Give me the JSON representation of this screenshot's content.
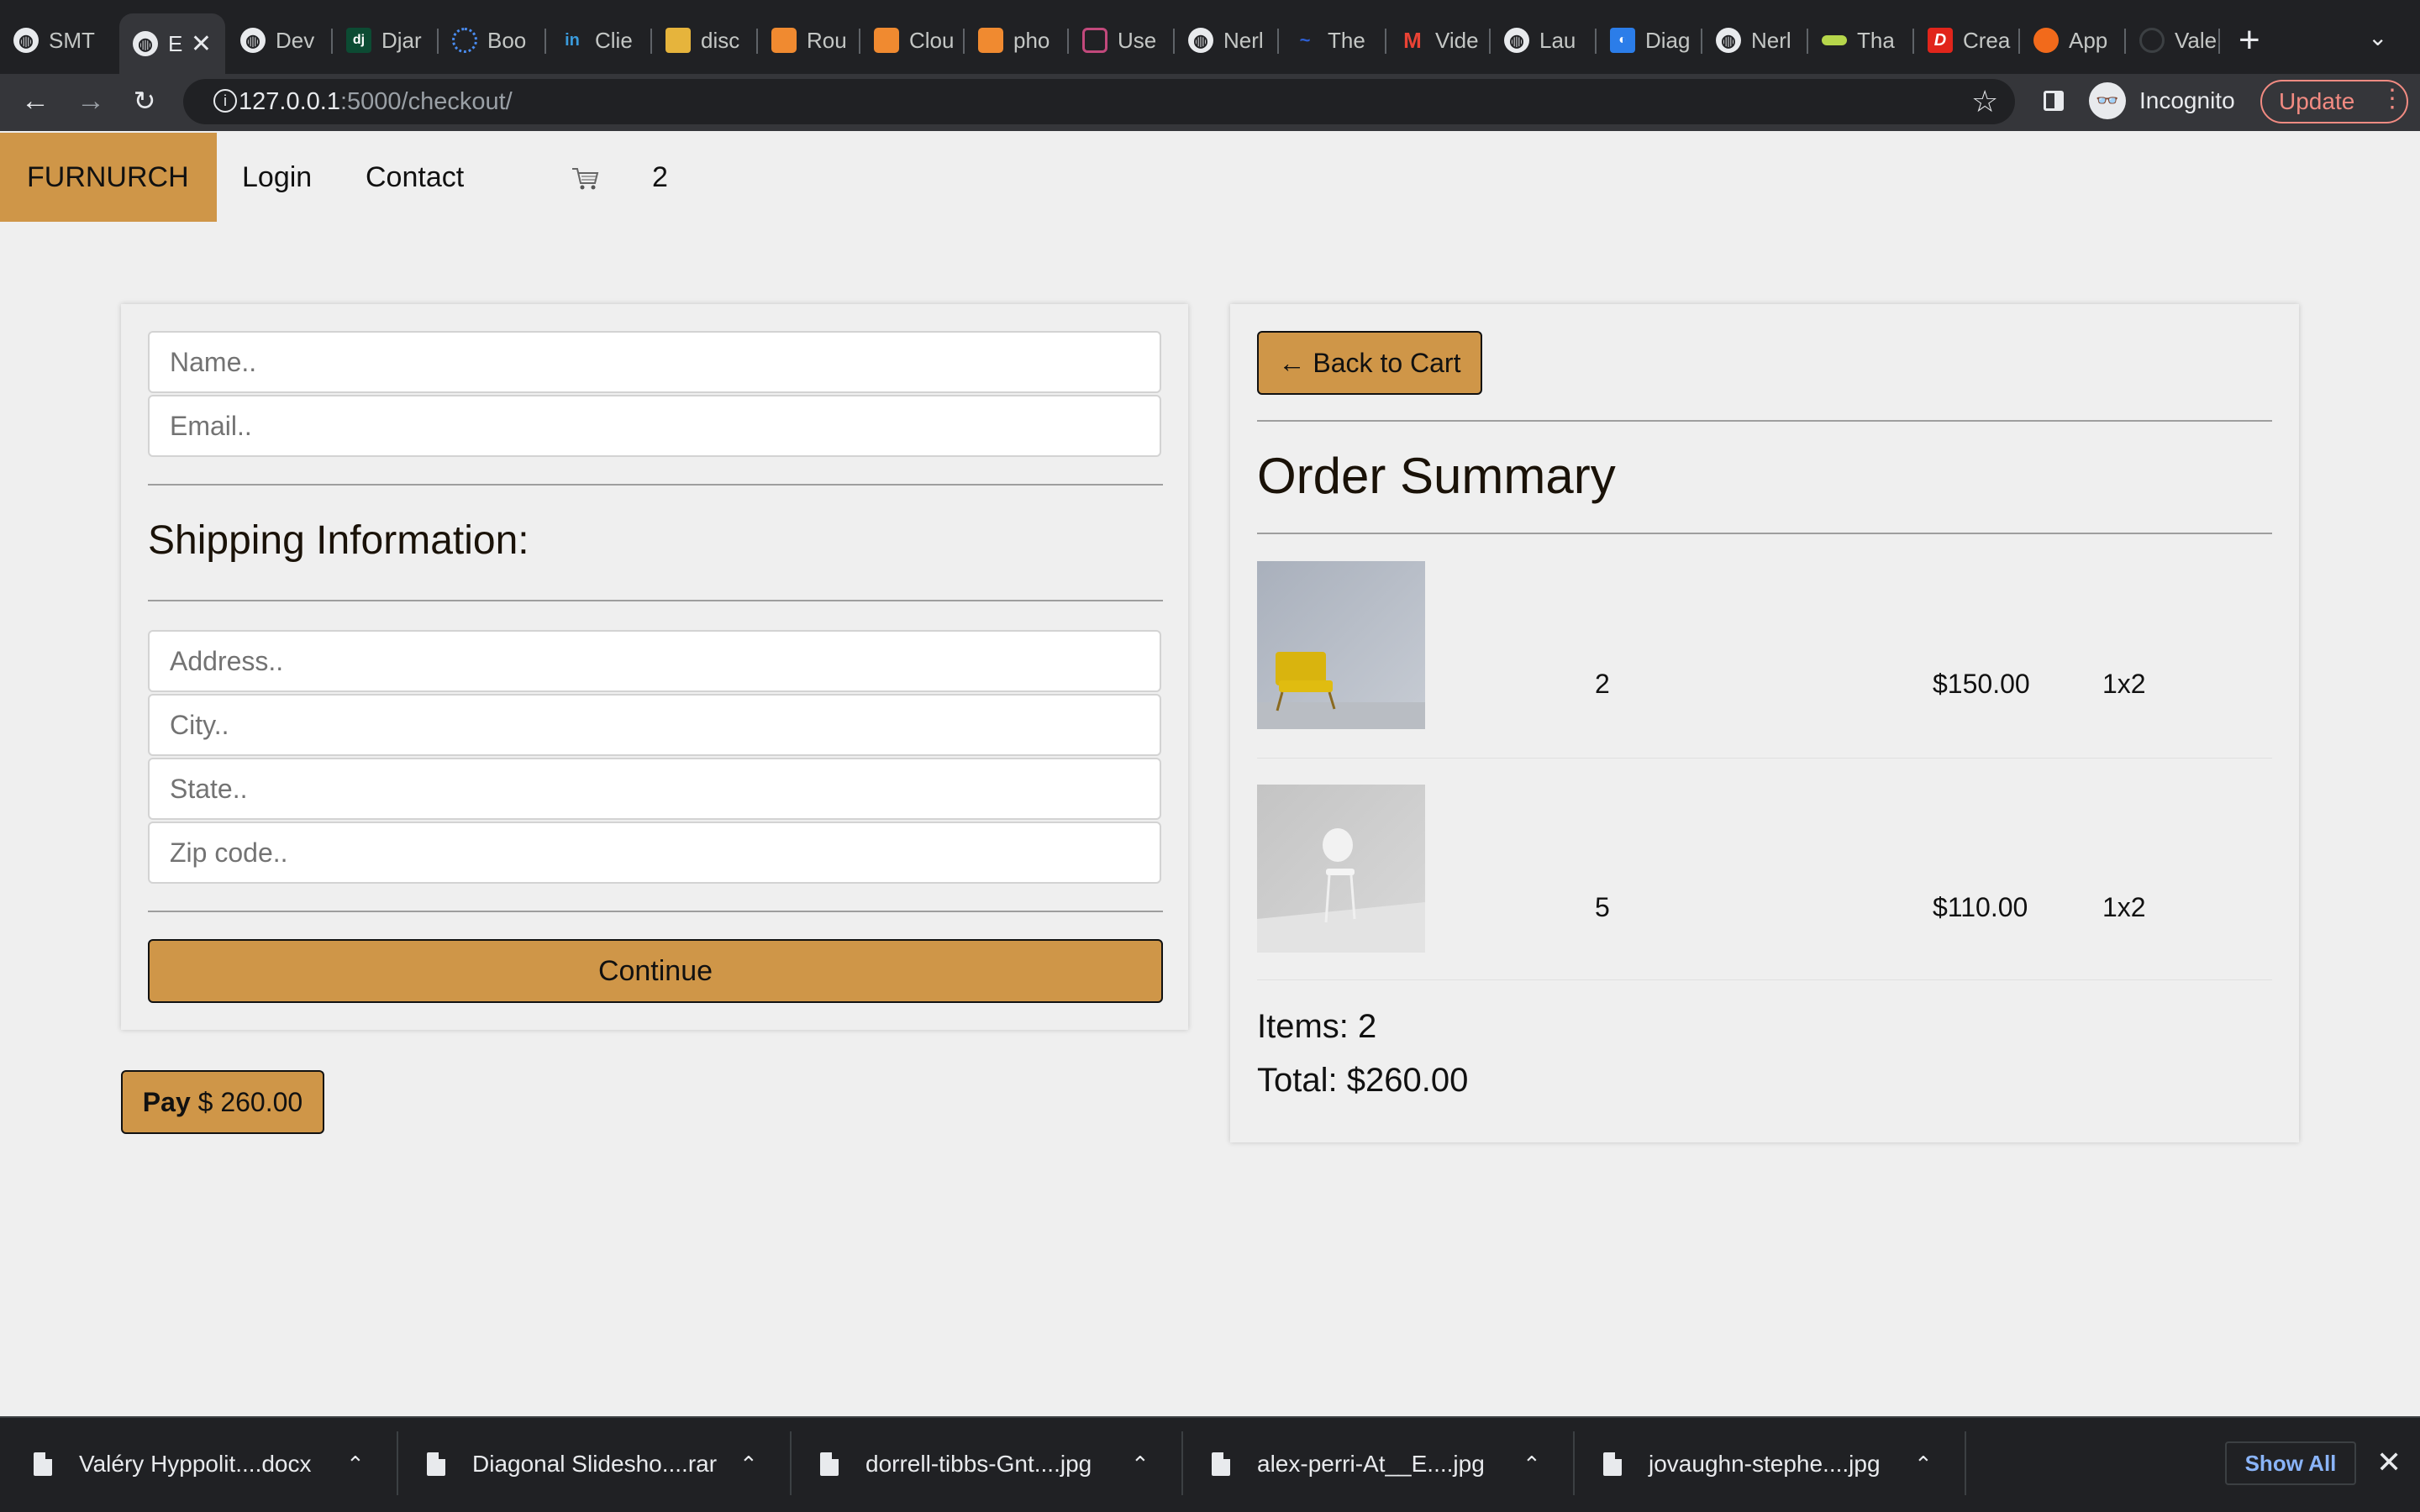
{
  "browser": {
    "tabs": [
      {
        "label": "SMT",
        "icon": "globe-icon"
      },
      {
        "label": "E",
        "icon": "globe-icon",
        "active": true
      },
      {
        "label": "Dev",
        "icon": "globe-icon"
      },
      {
        "label": "Djar",
        "icon": "django-icon"
      },
      {
        "label": "Boo",
        "icon": "loading-icon"
      },
      {
        "label": "Clie",
        "icon": "linkedin-icon"
      },
      {
        "label": "disc",
        "icon": "package-icon"
      },
      {
        "label": "Rou",
        "icon": "aws-cube-icon"
      },
      {
        "label": "Clou",
        "icon": "aws-cube-icon"
      },
      {
        "label": "pho",
        "icon": "aws-cube-icon"
      },
      {
        "label": "Use",
        "icon": "cognito-icon"
      },
      {
        "label": "Nerl",
        "icon": "globe-icon"
      },
      {
        "label": "The",
        "icon": "wave-icon"
      },
      {
        "label": "Vide",
        "icon": "gmail-icon"
      },
      {
        "label": "Lau",
        "icon": "globe-icon"
      },
      {
        "label": "Diag",
        "icon": "diagram-icon"
      },
      {
        "label": "Nerl",
        "icon": "globe-icon"
      },
      {
        "label": "Tha",
        "icon": "link-icon"
      },
      {
        "label": "Crea",
        "icon": "d-icon"
      },
      {
        "label": "App",
        "icon": "firefox-icon"
      },
      {
        "label": "Vale",
        "icon": "github-icon"
      }
    ],
    "url_host": "127.0.0.1",
    "url_path": ":5000/checkout/",
    "incognito_label": "Incognito",
    "update_label": "Update"
  },
  "site": {
    "brand": "FURNURCH",
    "nav": {
      "login": "Login",
      "contact": "Contact"
    },
    "cart_count": "2"
  },
  "form": {
    "name_placeholder": "Name..",
    "email_placeholder": "Email..",
    "shipping_title": "Shipping Information:",
    "address_placeholder": "Address..",
    "city_placeholder": "City..",
    "state_placeholder": "State..",
    "zip_placeholder": "Zip code..",
    "continue_label": "Continue"
  },
  "pay": {
    "bold": "Pay",
    "amount": " $ 260.00"
  },
  "summary": {
    "back_label": "← Back to Cart",
    "title": "Order Summary",
    "rows": [
      {
        "image": "yellow-chair",
        "col1": "2",
        "price": "$150.00",
        "qty": "1x2"
      },
      {
        "image": "white-chair",
        "col1": "5",
        "price": "$110.00",
        "qty": "1x2"
      }
    ],
    "items": "Items: 2",
    "total": "Total: $260.00"
  },
  "downloads": {
    "items": [
      "Valéry Hyppolit....docx",
      "Diagonal Slidesho....rar",
      "dorrell-tibbs-Gnt....jpg",
      "alex-perri-At__E....jpg",
      "jovaughn-stephe....jpg"
    ],
    "show_all": "Show All"
  }
}
